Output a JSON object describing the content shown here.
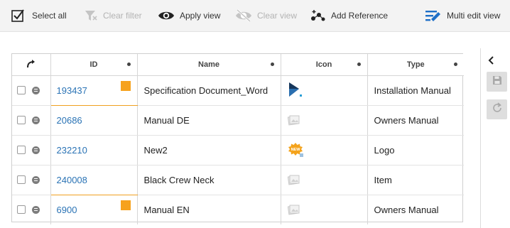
{
  "toolbar": {
    "select_all": "Select all",
    "clear_filter": "Clear filter",
    "apply_view": "Apply view",
    "clear_view": "Clear view",
    "add_reference": "Add Reference",
    "multi_edit_view": "Multi edit view"
  },
  "grid": {
    "columns": [
      "ID",
      "Name",
      "Icon",
      "Type"
    ],
    "rows": [
      {
        "id": "193437",
        "name": "Specification Document_Word",
        "icon": "play-brand-icon",
        "type": "Installation Manual",
        "flag": true
      },
      {
        "id": "20686",
        "name": "Manual DE",
        "icon": "placeholder-image-icon",
        "type": "Owners Manual",
        "flag": false
      },
      {
        "id": "232210",
        "name": "New2",
        "icon": "new-badge-icon",
        "type": "Logo",
        "flag": false
      },
      {
        "id": "240008",
        "name": "Black Crew Neck",
        "icon": "placeholder-image-icon",
        "type": "Item",
        "flag": false
      },
      {
        "id": "6900",
        "name": "Manual EN",
        "icon": "placeholder-image-icon",
        "type": "Owners Manual",
        "flag": true
      }
    ]
  },
  "new_badge_text": "NEW",
  "colors": {
    "accent_blue": "#2a73b5",
    "flag_orange": "#f6a21d"
  }
}
